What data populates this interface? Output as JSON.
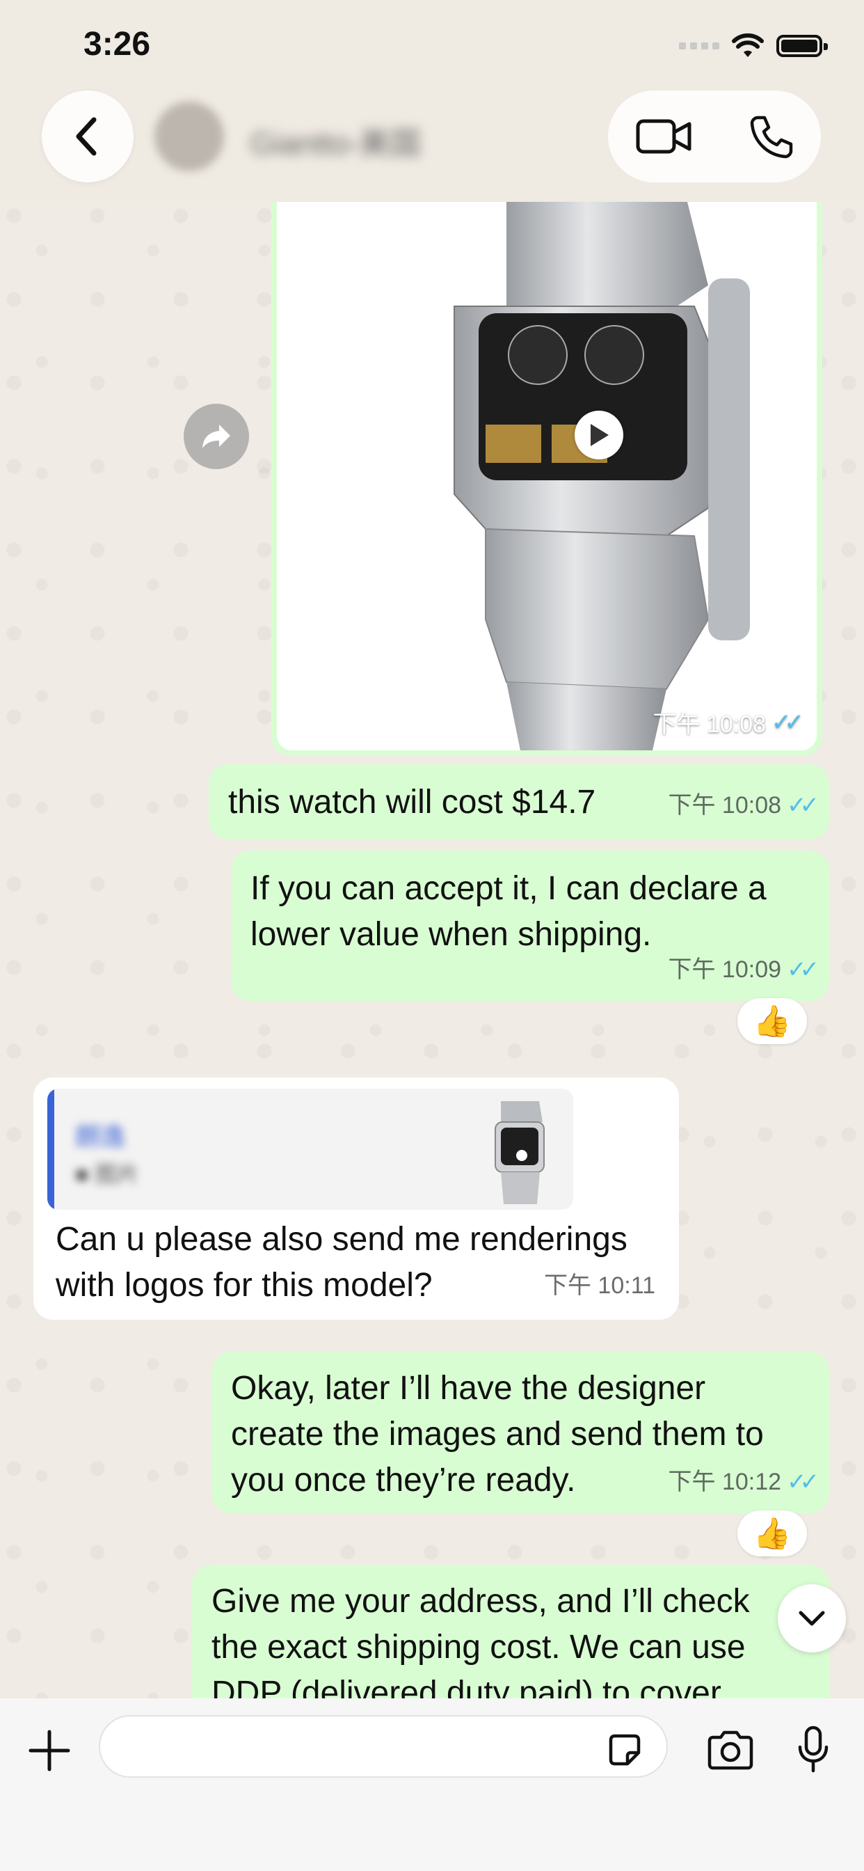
{
  "status_bar": {
    "time": "3:26"
  },
  "header": {
    "contact_name": "Giantto-美国"
  },
  "messages": [
    {
      "id": "m0",
      "type": "video",
      "time": "下午 10:08",
      "ticks": "✓✓"
    },
    {
      "id": "m1",
      "direction": "out",
      "text": "this watch will cost $14.7",
      "time": "下午 10:08",
      "ticks": "✓✓"
    },
    {
      "id": "m2",
      "direction": "out",
      "text_lines": [
        "If you can accept it, I can declare a",
        "lower value when shipping."
      ],
      "time": "下午 10:09",
      "ticks": "✓✓",
      "reaction": "👍"
    },
    {
      "id": "m3",
      "direction": "in",
      "quote": {
        "author": "朗逸",
        "label": "■ 图片"
      },
      "text_lines": [
        "Can u please also send me renderings",
        "with logos for this model?"
      ],
      "time": "下午 10:11"
    },
    {
      "id": "m4",
      "direction": "out",
      "text_lines": [
        "Okay, later I’ll have the designer",
        "create the images and send them to",
        "you once they’re ready."
      ],
      "time": "下午 10:12",
      "ticks": "✓✓",
      "reaction": "👍"
    },
    {
      "id": "m5",
      "direction": "out",
      "text_lines": [
        "Give me your address, and I’ll check",
        "the exact shipping cost. We can use",
        "DDP (delivered duty paid) to cover"
      ]
    }
  ],
  "icons": {
    "back": "chevron-left-icon",
    "video_call": "video-camera-icon",
    "voice_call": "phone-icon",
    "forward": "forward-arrow-icon",
    "play": "play-icon",
    "scroll_down": "chevron-down-icon",
    "attach": "plus-icon",
    "sticker": "sticker-icon",
    "camera": "camera-icon",
    "mic": "microphone-icon"
  },
  "colors": {
    "outgoing_bubble": "#d9fdd3",
    "incoming_bubble": "#ffffff",
    "read_ticks": "#53bdeb",
    "quote_accent": "#3a63d6"
  }
}
